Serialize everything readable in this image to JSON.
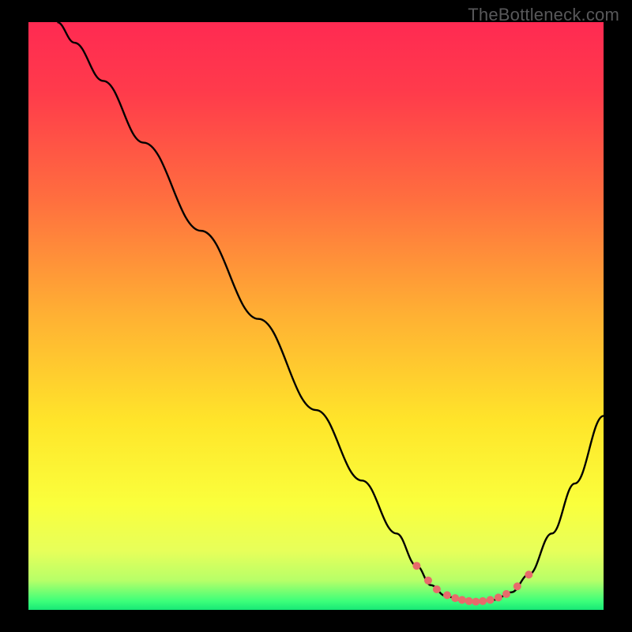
{
  "watermark": "TheBottleneck.com",
  "chart_data": {
    "type": "line",
    "title": "",
    "xlabel": "",
    "ylabel": "",
    "xlim": [
      0,
      100
    ],
    "ylim": [
      0,
      100
    ],
    "background_gradient": {
      "stops": [
        {
          "offset": 0.0,
          "color": "#ff2a52"
        },
        {
          "offset": 0.12,
          "color": "#ff3b4b"
        },
        {
          "offset": 0.3,
          "color": "#ff6e3f"
        },
        {
          "offset": 0.5,
          "color": "#ffb133"
        },
        {
          "offset": 0.68,
          "color": "#ffe52a"
        },
        {
          "offset": 0.82,
          "color": "#faff3c"
        },
        {
          "offset": 0.9,
          "color": "#e7ff5a"
        },
        {
          "offset": 0.95,
          "color": "#b7ff68"
        },
        {
          "offset": 0.985,
          "color": "#3dff7a"
        },
        {
          "offset": 1.0,
          "color": "#17e876"
        }
      ]
    },
    "series": [
      {
        "name": "bottleneck-curve",
        "color": "#000000",
        "points": [
          {
            "x": 5.0,
            "y": 100.0
          },
          {
            "x": 8.0,
            "y": 96.5
          },
          {
            "x": 13.0,
            "y": 90.0
          },
          {
            "x": 20.0,
            "y": 79.5
          },
          {
            "x": 30.0,
            "y": 64.5
          },
          {
            "x": 40.0,
            "y": 49.5
          },
          {
            "x": 50.0,
            "y": 34.0
          },
          {
            "x": 58.0,
            "y": 22.0
          },
          {
            "x": 64.0,
            "y": 13.0
          },
          {
            "x": 67.5,
            "y": 7.5
          },
          {
            "x": 70.0,
            "y": 4.2
          },
          {
            "x": 72.5,
            "y": 2.4
          },
          {
            "x": 75.0,
            "y": 1.7
          },
          {
            "x": 78.0,
            "y": 1.4
          },
          {
            "x": 81.0,
            "y": 1.7
          },
          {
            "x": 84.0,
            "y": 3.0
          },
          {
            "x": 87.0,
            "y": 6.0
          },
          {
            "x": 91.0,
            "y": 13.0
          },
          {
            "x": 95.0,
            "y": 21.5
          },
          {
            "x": 100.0,
            "y": 33.0
          }
        ]
      },
      {
        "name": "optimal-markers",
        "color": "#e76b6b",
        "marker_radius_px": 5,
        "points": [
          {
            "x": 67.5,
            "y": 7.5
          },
          {
            "x": 69.5,
            "y": 5.0
          },
          {
            "x": 71.0,
            "y": 3.5
          },
          {
            "x": 72.8,
            "y": 2.5
          },
          {
            "x": 74.2,
            "y": 2.0
          },
          {
            "x": 75.4,
            "y": 1.7
          },
          {
            "x": 76.6,
            "y": 1.5
          },
          {
            "x": 77.8,
            "y": 1.4
          },
          {
            "x": 79.0,
            "y": 1.5
          },
          {
            "x": 80.3,
            "y": 1.7
          },
          {
            "x": 81.7,
            "y": 2.1
          },
          {
            "x": 83.1,
            "y": 2.7
          },
          {
            "x": 85.0,
            "y": 4.0
          },
          {
            "x": 87.0,
            "y": 6.0
          }
        ]
      }
    ]
  }
}
